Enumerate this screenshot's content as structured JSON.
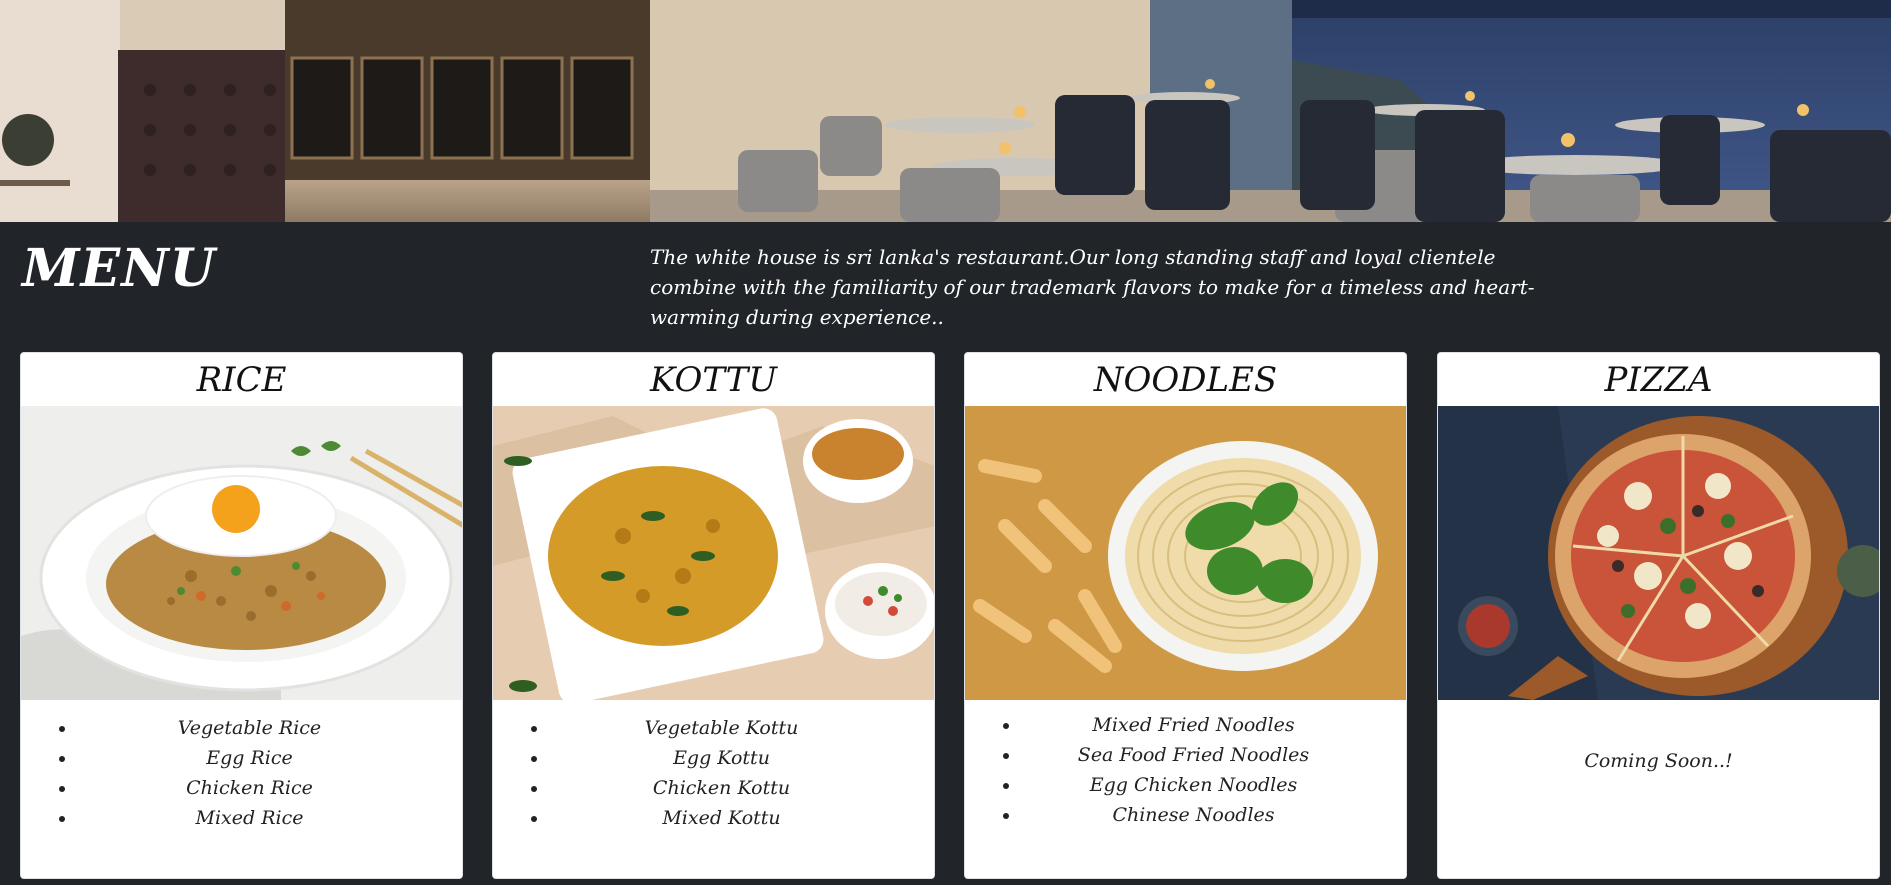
{
  "header": {
    "title": "MENU",
    "intro": "The white house is sri lanka's restaurant.Our long standing staff and loyal clientele combine with the familiarity of our trademark flavors to make for a timeless and heart-warming during experience.."
  },
  "cards": [
    {
      "title": "RICE",
      "items": [
        "Vegetable Rice",
        "Egg Rice",
        "Chicken Rice",
        "Mixed Rice"
      ]
    },
    {
      "title": "KOTTU",
      "items": [
        "Vegetable Kottu",
        "Egg Kottu",
        "Chicken Kottu",
        "Mixed Kottu"
      ]
    },
    {
      "title": "NOODLES",
      "items": [
        "Mixed Fried Noodles",
        "Sea Food Fried Noodles",
        "Egg Chicken Noodles",
        "Chinese Noodles"
      ]
    },
    {
      "title": "PIZZA",
      "coming_soon": "Coming Soon..!"
    }
  ],
  "colors": {
    "page_background": "#212529",
    "card_background": "#ffffff",
    "text_light": "#ffffff"
  }
}
